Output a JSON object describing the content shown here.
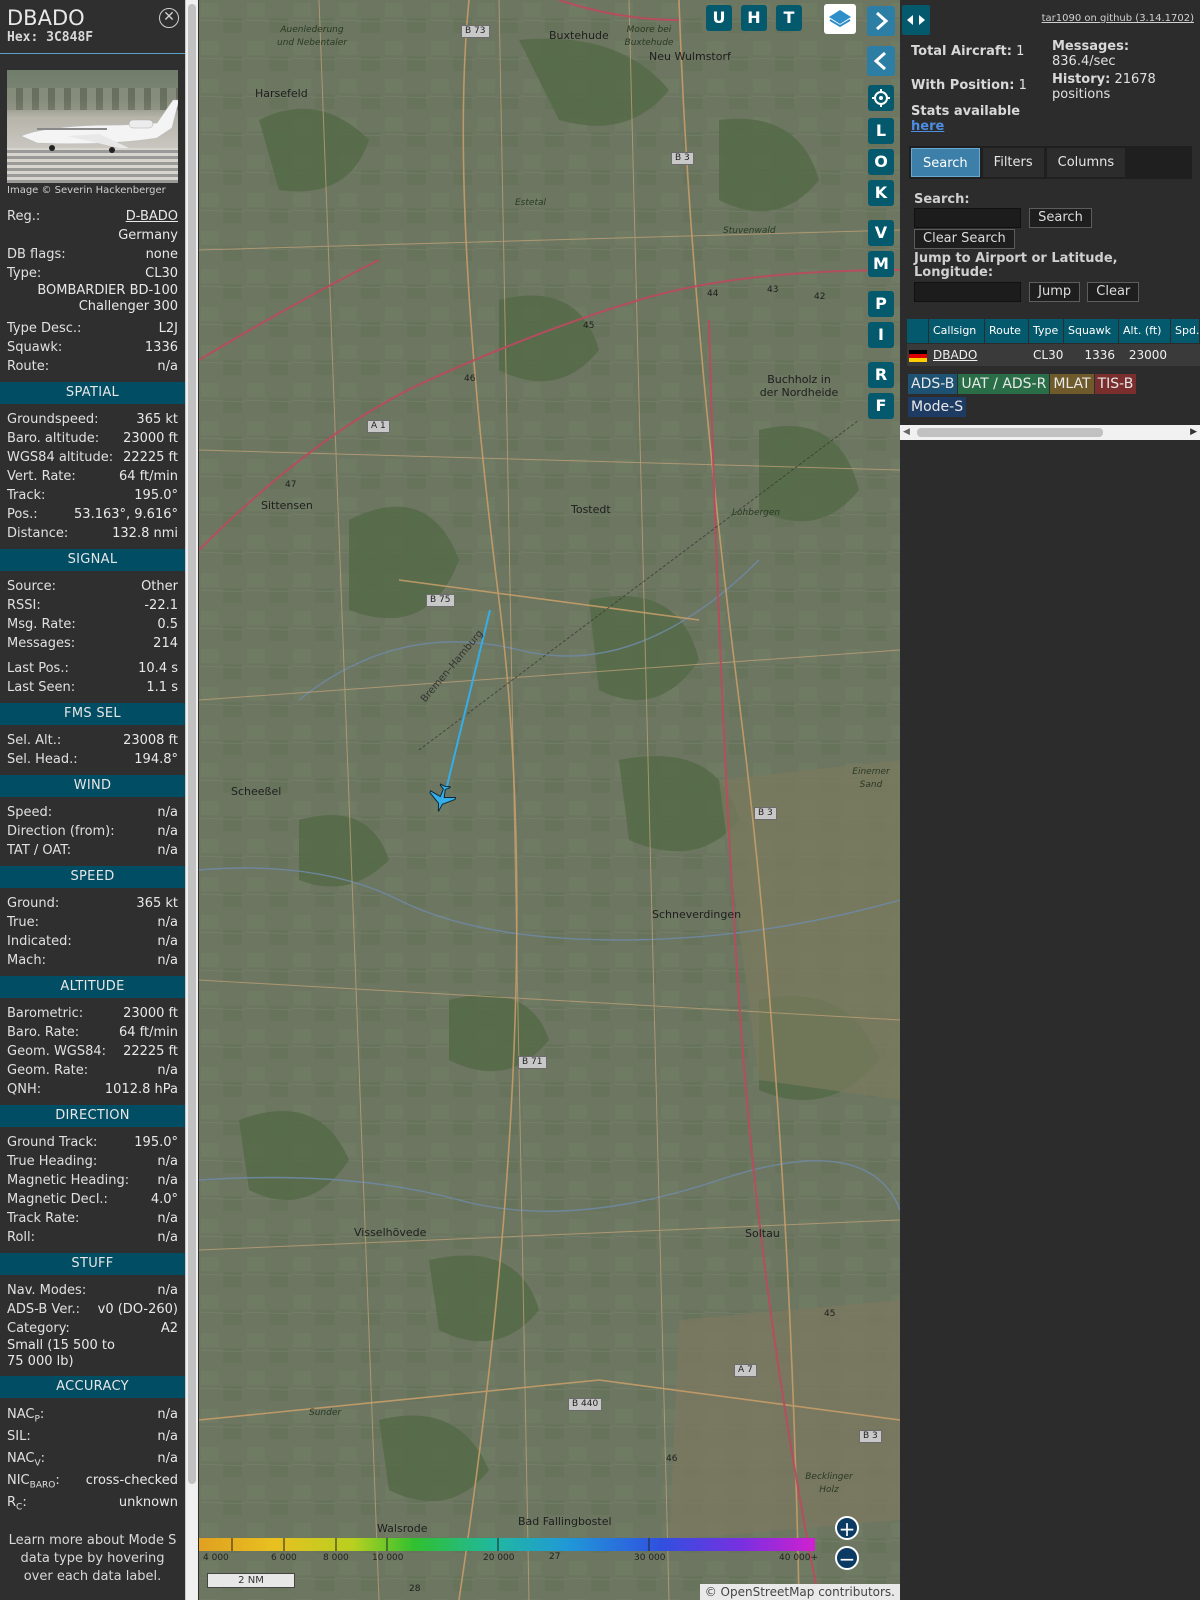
{
  "selected": {
    "callsign": "DBADO",
    "hex_label": "Hex:",
    "hex": "3C848F",
    "image_credit": "Image © Severin Hackenberger",
    "rows1": [
      {
        "k": "Reg.:",
        "v": "D-BADO",
        "link": true
      },
      {
        "k": "",
        "v": "Germany"
      },
      {
        "k": "DB flags:",
        "v": "none"
      },
      {
        "k": "Type:",
        "v": "CL30"
      }
    ],
    "type_full_1": "BOMBARDIER BD-100",
    "type_full_2": "Challenger 300",
    "rows2": [
      {
        "k": "Type Desc.:",
        "v": "L2J"
      },
      {
        "k": "Squawk:",
        "v": "1336"
      },
      {
        "k": "Route:",
        "v": "n/a"
      }
    ]
  },
  "sections": {
    "spatial": {
      "title": "SPATIAL",
      "rows": [
        {
          "k": "Groundspeed:",
          "v": "365 kt"
        },
        {
          "k": "Baro. altitude:",
          "v": "23000 ft"
        },
        {
          "k": "WGS84 altitude:",
          "v": "22225 ft"
        },
        {
          "k": "Vert. Rate:",
          "v": "64 ft/min"
        },
        {
          "k": "Track:",
          "v": "195.0°"
        },
        {
          "k": "Pos.:",
          "v": "53.163°, 9.616°"
        },
        {
          "k": "Distance:",
          "v": "132.8 nmi"
        }
      ]
    },
    "signal": {
      "title": "SIGNAL",
      "rows": [
        {
          "k": "Source:",
          "v": "Other"
        },
        {
          "k": "RSSI:",
          "v": "-22.1"
        },
        {
          "k": "Msg. Rate:",
          "v": "0.5"
        },
        {
          "k": "Messages:",
          "v": "214"
        }
      ],
      "rows_b": [
        {
          "k": "Last Pos.:",
          "v": "10.4 s"
        },
        {
          "k": "Last Seen:",
          "v": "1.1 s"
        }
      ]
    },
    "fms": {
      "title": "FMS SEL",
      "rows": [
        {
          "k": "Sel. Alt.:",
          "v": "23008 ft"
        },
        {
          "k": "Sel. Head.:",
          "v": "194.8°"
        }
      ]
    },
    "wind": {
      "title": "WIND",
      "rows": [
        {
          "k": "Speed:",
          "v": "n/a"
        },
        {
          "k": "Direction (from):",
          "v": "n/a"
        },
        {
          "k": "TAT / OAT:",
          "v": "n/a"
        }
      ]
    },
    "speed": {
      "title": "SPEED",
      "rows": [
        {
          "k": "Ground:",
          "v": "365 kt"
        },
        {
          "k": "True:",
          "v": "n/a"
        },
        {
          "k": "Indicated:",
          "v": "n/a"
        },
        {
          "k": "Mach:",
          "v": "n/a"
        }
      ]
    },
    "altitude": {
      "title": "ALTITUDE",
      "rows": [
        {
          "k": "Barometric:",
          "v": "23000 ft"
        },
        {
          "k": "Baro. Rate:",
          "v": "64 ft/min"
        },
        {
          "k": "Geom. WGS84:",
          "v": "22225 ft"
        },
        {
          "k": "Geom. Rate:",
          "v": "n/a"
        },
        {
          "k": "QNH:",
          "v": "1012.8 hPa"
        }
      ]
    },
    "direction": {
      "title": "DIRECTION",
      "rows": [
        {
          "k": "Ground Track:",
          "v": "195.0°"
        },
        {
          "k": "True Heading:",
          "v": "n/a"
        },
        {
          "k": "Magnetic Heading:",
          "v": "n/a"
        },
        {
          "k": "Magnetic Decl.:",
          "v": "4.0°"
        },
        {
          "k": "Track Rate:",
          "v": "n/a"
        },
        {
          "k": "Roll:",
          "v": "n/a"
        }
      ]
    },
    "stuff": {
      "title": "STUFF",
      "rows": [
        {
          "k": "Nav. Modes:",
          "v": "n/a"
        },
        {
          "k": "ADS-B Ver.:",
          "v": "v0 (DO-260)"
        },
        {
          "k": "Category:",
          "v": "A2"
        }
      ],
      "category_desc_1": "Small (15 500 to",
      "category_desc_2": "75 000 lb)"
    },
    "accuracy": {
      "title": "ACCURACY",
      "nacp": "NAC",
      "nacp_sub": "P",
      "nacp_v": "n/a",
      "sil": "SIL:",
      "sil_v": "n/a",
      "nacv": "NAC",
      "nacv_sub": "V",
      "nacv_v": "n/a",
      "nicb": "NIC",
      "nicb_sub": "BARO",
      "nicb_v": "cross-checked",
      "rc": "R",
      "rc_sub": "C",
      "rc_v": "unknown"
    },
    "note": "Learn more about Mode S data type by hovering over each data label."
  },
  "map": {
    "buttons": [
      "U",
      "H",
      "T"
    ],
    "side_buttons": [
      "L",
      "O",
      "K",
      "V",
      "M",
      "P",
      "I",
      "R",
      "F"
    ],
    "places": [
      {
        "name": "Buxtehude"
      },
      {
        "name": "Neu Wulmstorf"
      },
      {
        "name": "Harsefeld"
      },
      {
        "name": "Sittensen"
      },
      {
        "name": "Tostedt"
      },
      {
        "name": "Buchholz in der Nordheide"
      },
      {
        "name": "Scheeßel"
      },
      {
        "name": "Schneverdingen"
      },
      {
        "name": "Visselhövede"
      },
      {
        "name": "Soltau"
      },
      {
        "name": "Walsrode"
      },
      {
        "name": "Bad Fallingbostel"
      }
    ],
    "italic_places": [
      {
        "name": "Auenlederung und Nebentaler"
      },
      {
        "name": "Moore bei Buxtehude"
      },
      {
        "name": "Estetal"
      },
      {
        "name": "Stuvenwald"
      },
      {
        "name": "Lohbergen"
      },
      {
        "name": "Einemer Sand"
      },
      {
        "name": "Sunder"
      },
      {
        "name": "Becklinger Holz"
      }
    ],
    "roads": [
      "B 73",
      "B 3",
      "A 1",
      "B 75",
      "B 3",
      "B 71",
      "A 7",
      "B 440",
      "B 3"
    ],
    "motorway_numbers": [
      "44",
      "43",
      "42",
      "45",
      "46",
      "47",
      "27",
      "28",
      "45",
      "46"
    ],
    "route_label": "Bremen–Hamburg",
    "altitude_scale": [
      "4 000",
      "6 000",
      "8 000",
      "10 000",
      "20 000",
      "30 000",
      "40 000+"
    ],
    "scale": "2 NM",
    "attribution": "© OpenStreetMap contributors."
  },
  "side": {
    "github": "tar1090 on github (3.14.1702)",
    "total_label": "Total Aircraft:",
    "total": "1",
    "withpos_label": "With Position:",
    "withpos": "1",
    "messages_label": "Messages:",
    "messages": "836.4/sec",
    "history_label": "History:",
    "history": "21678 positions",
    "stats_label": "Stats available",
    "stats_link": "here",
    "tabs": [
      "Search",
      "Filters",
      "Columns"
    ],
    "search_label": "Search:",
    "search_btn": "Search",
    "clear_search_btn": "Clear Search",
    "jump_label": "Jump to Airport or Latitude, Longitude:",
    "jump_btn": "Jump",
    "clear_btn": "Clear",
    "columns": [
      "",
      "Callsign",
      "Route",
      "Type",
      "Squawk",
      "Alt. (ft)",
      "Spd."
    ],
    "row": {
      "callsign": "DBADO",
      "route": "",
      "type": "CL30",
      "squawk": "1336",
      "alt": "23000",
      "spd": ""
    },
    "legend": [
      {
        "label": "ADS-B",
        "color": "#1d5273"
      },
      {
        "label": "UAT / ADS-R",
        "color": "#2a6e47"
      },
      {
        "label": "MLAT",
        "color": "#6e5a2a"
      },
      {
        "label": "TIS-B",
        "color": "#7a2e2e"
      },
      {
        "label": "Mode-S",
        "color": "#1d3b63"
      }
    ]
  },
  "colors": {
    "accent": "#05596d",
    "track": "#35aee8"
  }
}
